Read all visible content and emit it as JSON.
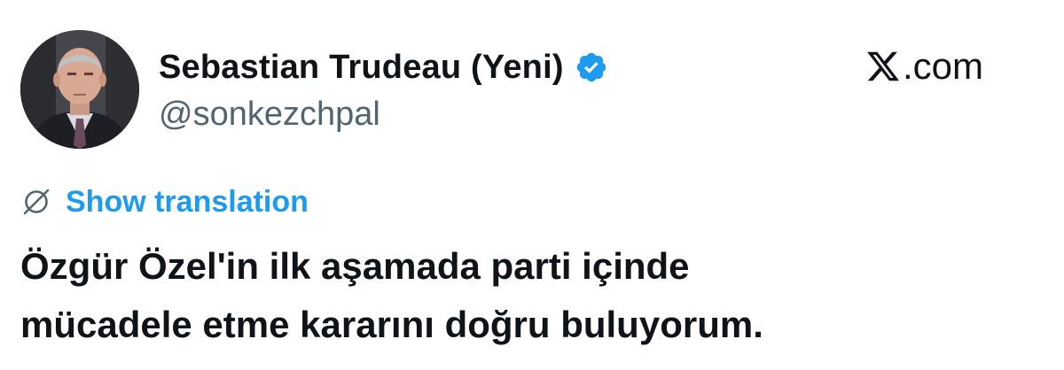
{
  "author": {
    "display_name": "Sebastian Trudeau (Yeni)",
    "handle": "@sonkezchpal",
    "verified": true,
    "avatar_icon": "profile-photo"
  },
  "brand": {
    "domain": ".com",
    "logo_icon": "x-logo-icon"
  },
  "translation": {
    "label": "Show translation",
    "icon": "globe-icon"
  },
  "tweet": {
    "lines": [
      "Özgür Özel'in ilk aşamada parti içinde",
      "mücadele etme kararını doğru buluyorum."
    ]
  },
  "colors": {
    "accent": "#1d9bf0",
    "text": "#0f1419",
    "secondary_text": "#536471"
  }
}
